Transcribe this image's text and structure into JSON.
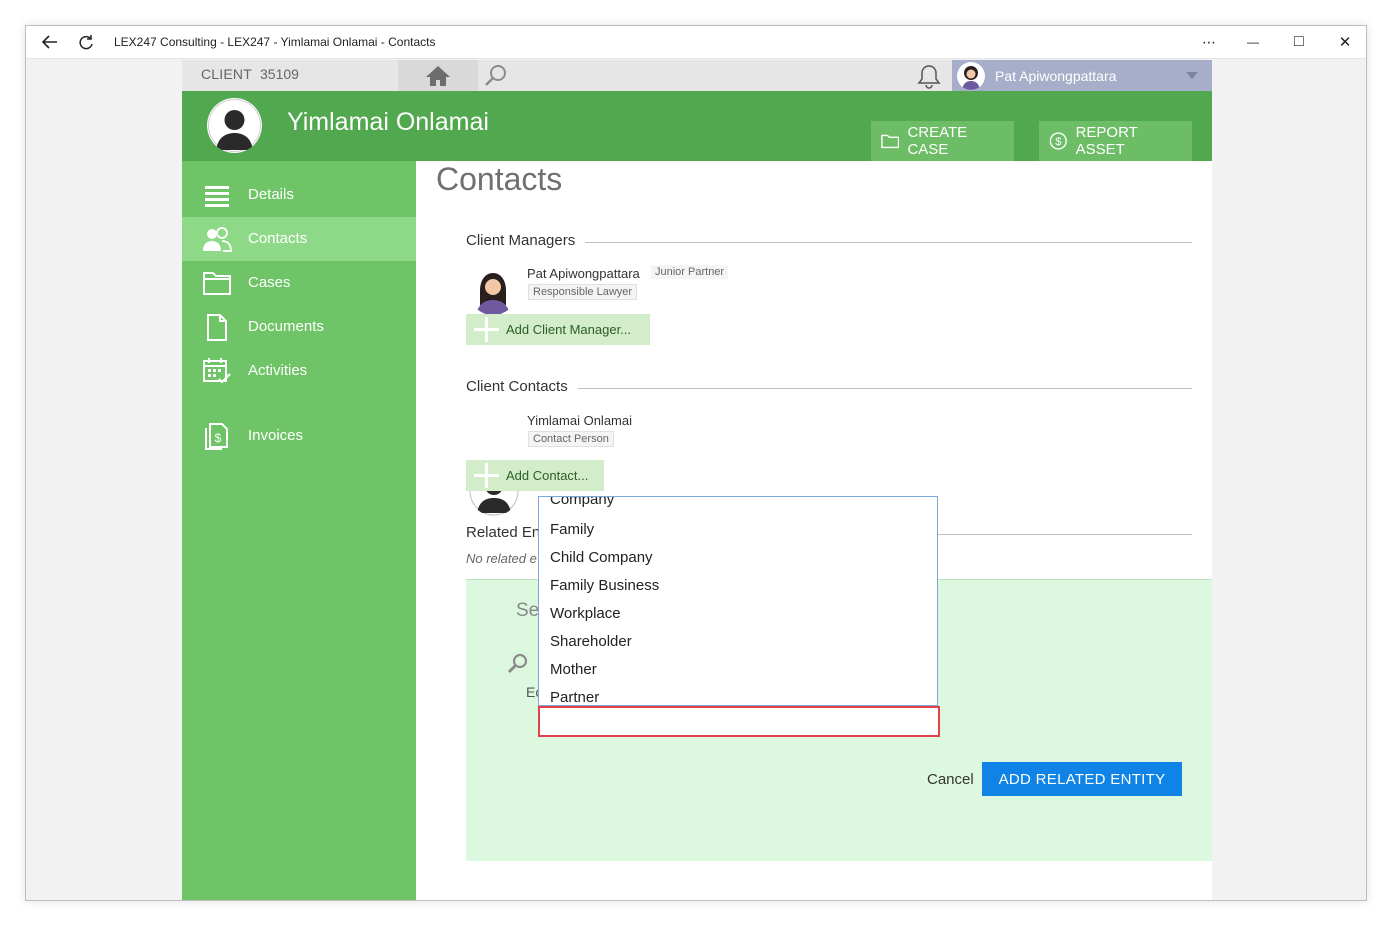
{
  "window": {
    "title": "LEX247 Consulting - LEX247 - Yimlamai Onlamai - Contacts",
    "controls": {
      "more": "⋯",
      "minimize": "—",
      "maximize": "□",
      "close": "✕"
    }
  },
  "topbar": {
    "client_label": "CLIENT",
    "client_number": "35109",
    "user_name": "Pat Apiwongpattara"
  },
  "header": {
    "client_name": "Yimlamai Onlamai",
    "create_case": "CREATE CASE",
    "report_asset": "REPORT ASSET"
  },
  "sidebar": {
    "items": [
      {
        "label": "Details",
        "icon": "list-icon"
      },
      {
        "label": "Contacts",
        "icon": "people-icon"
      },
      {
        "label": "Cases",
        "icon": "folder-icon"
      },
      {
        "label": "Documents",
        "icon": "document-icon"
      },
      {
        "label": "Activities",
        "icon": "calendar-check-icon"
      },
      {
        "label": "Invoices",
        "icon": "invoice-icon"
      }
    ]
  },
  "main": {
    "page_title": "Contacts",
    "client_managers": {
      "title": "Client Managers",
      "person_name": "Pat Apiwongpattara",
      "person_role": "Junior Partner",
      "person_tag": "Responsible Lawyer",
      "add_label": "Add Client Manager..."
    },
    "client_contacts": {
      "title": "Client Contacts",
      "person_name": "Yimlamai Onlamai",
      "person_tag": "Contact Person",
      "add_label": "Add Contact..."
    },
    "related": {
      "title_partial": "Related En",
      "empty_partial": "No related e"
    },
    "panel": {
      "select_partial": "Se",
      "ed_partial": "Ec",
      "cancel": "Cancel",
      "add_related": "ADD RELATED ENTITY"
    }
  },
  "dropdown": {
    "options": [
      "Company",
      "Family",
      "Child Company",
      "Family Business",
      "Workplace",
      "Shareholder",
      "Mother",
      "Partner"
    ],
    "input_value": ""
  },
  "colors": {
    "header_green": "#52a84e",
    "sidebar_green": "#6ec466",
    "active_green": "#8ed987",
    "panel_green": "#dcf8df",
    "primary_blue": "#0f84e6",
    "focus_red": "#e3424c"
  }
}
